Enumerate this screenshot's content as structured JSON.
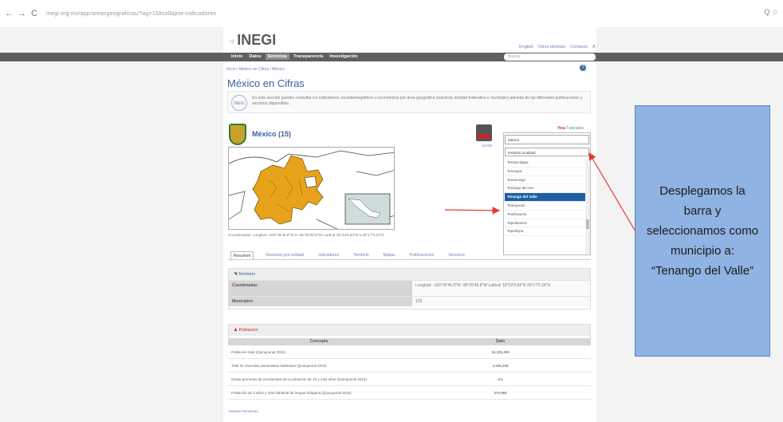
{
  "browser": {
    "back": "←",
    "forward": "→",
    "reload": "C",
    "url": "inegi.org.mx/app/areasgeograficas/?ag=15#collapse-Indicadores",
    "right_icons": "Q ☆"
  },
  "site": {
    "logo_prefix": "INEGI",
    "logo": "INEGI",
    "toplinks": [
      "English",
      "Otros idiomas",
      "Contacto",
      "A"
    ],
    "nav": [
      "Inicio",
      "Datos",
      "Servicios",
      "Transparencia",
      "Investigación"
    ],
    "search_placeholder": "Buscar",
    "breadcrumb": "Inicio / México en Cifras / México",
    "help": "?"
  },
  "page": {
    "title": "México en Cifras",
    "intro_icon": "INEGI",
    "intro": "En esta sección puedes consultar los indicadores sociodemográficos y económicos por área geográfica (nacional, entidad federativa o municipio) además de las diferentes publicaciones y servicios disponibles.",
    "state_name": "México (15)",
    "pdf_label": "15 MB",
    "youtube_label": "You",
    "youtube_link": "Tutoriales",
    "coordinates": "Coordenadas: Longitud -100°36'46.8\"W a -98°35'46.8\"W; Latitud 18°22'0.84\"N a 20°17'0.24\"N",
    "tabs": [
      "Resumen",
      "Resumen por entidad",
      "Indicadores",
      "Territorio",
      "Mapas",
      "Publicaciones",
      "Servicios"
    ]
  },
  "territorio": {
    "header": "Territorio",
    "rows": [
      {
        "k": "Coordenadas",
        "v": "Longitud: -100°36'46.8\"W  -98°35'46.8\"W  Latitud: 18°22'0.84\"N  20°17'0.24\"N"
      },
      {
        "k": "Municipios",
        "v": "125"
      }
    ]
  },
  "poblacion": {
    "header": "Población",
    "col1": "Concepto",
    "col2": "Dato",
    "rows": [
      {
        "c": "Población total (Quinquenal 2015)",
        "v": "16,225,409"
      },
      {
        "c": "Total de viviendas particulares habitadas (Quinquenal 2015)",
        "v": "4,168,206"
      },
      {
        "c": "Grado promedio de escolaridad de la población de 15 y más años (Quinquenal 2015)",
        "v": "9.5"
      },
      {
        "c": "Población de 3 años y más hablante de lengua indígena (Quinquenal 2015)",
        "v": "379,959"
      }
    ],
    "more": "Mostrar Temáticas"
  },
  "dropdown": {
    "selected": "México",
    "filter": "Estado/Localidad",
    "items": [
      "Temascalapa",
      "Temoaya",
      "Tenancingo",
      "Tenango del Aire",
      "Tenango del Valle",
      "Teoloyucan",
      "Teotihuacán",
      "Tepetlaoxtoc",
      "Tepetlixpa"
    ],
    "highlighted": "Tenango del Valle"
  },
  "callout": {
    "text": "Desplegamos la barra y seleccionamos como municipio a: “Tenango del Valle”",
    "color": "#8fb3e2"
  }
}
